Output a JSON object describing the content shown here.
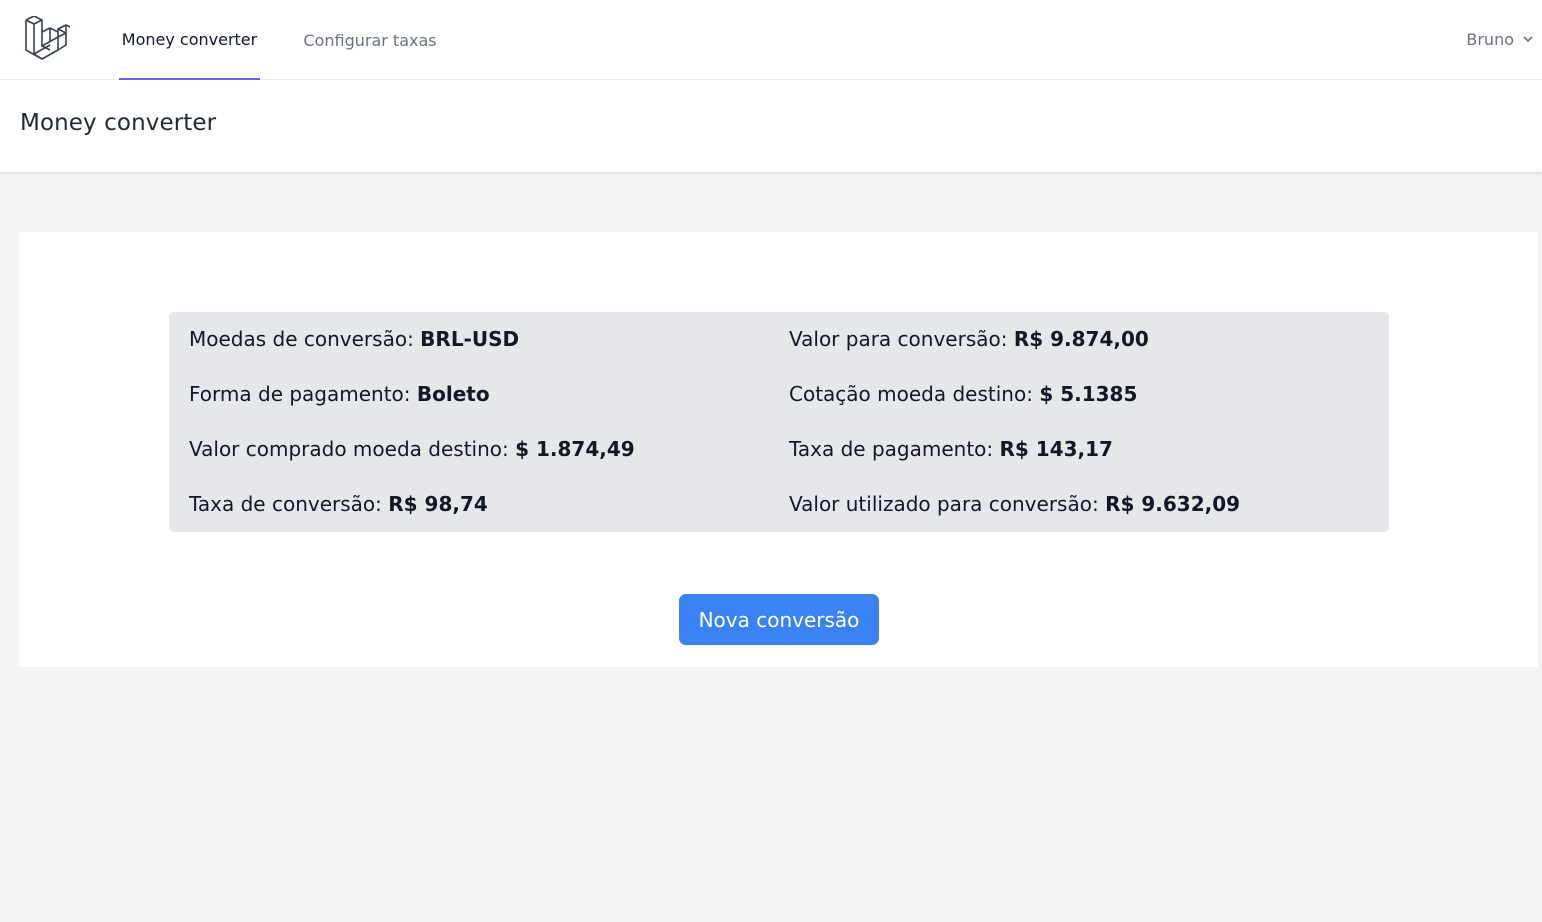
{
  "nav": {
    "links": [
      {
        "label": "Money converter",
        "active": true
      },
      {
        "label": "Configurar taxas",
        "active": false
      }
    ],
    "user": "Bruno",
    "accent_color": "#6366f1"
  },
  "header": {
    "title": "Money converter"
  },
  "summary": {
    "left": [
      {
        "label": "Moedas de conversão:",
        "value": "BRL-USD"
      },
      {
        "label": "Forma de pagamento:",
        "value": "Boleto"
      },
      {
        "label": "Valor comprado moeda destino:",
        "value": "$ 1.874,49"
      },
      {
        "label": "Taxa de conversão:",
        "value": "R$ 98,74"
      }
    ],
    "right": [
      {
        "label": "Valor para conversão:",
        "value": "R$ 9.874,00"
      },
      {
        "label": "Cotação moeda destino:",
        "value": "$ 5.1385"
      },
      {
        "label": "Taxa de pagamento:",
        "value": "R$ 143,17"
      },
      {
        "label": "Valor utilizado para conversão:",
        "value": "R$ 9.632,09"
      }
    ]
  },
  "actions": {
    "new_conversion_label": "Nova conversão",
    "button_color": "#3b82f6"
  },
  "icons": {
    "logo": "laravel-logo-icon",
    "dropdown": "chevron-down-icon"
  }
}
